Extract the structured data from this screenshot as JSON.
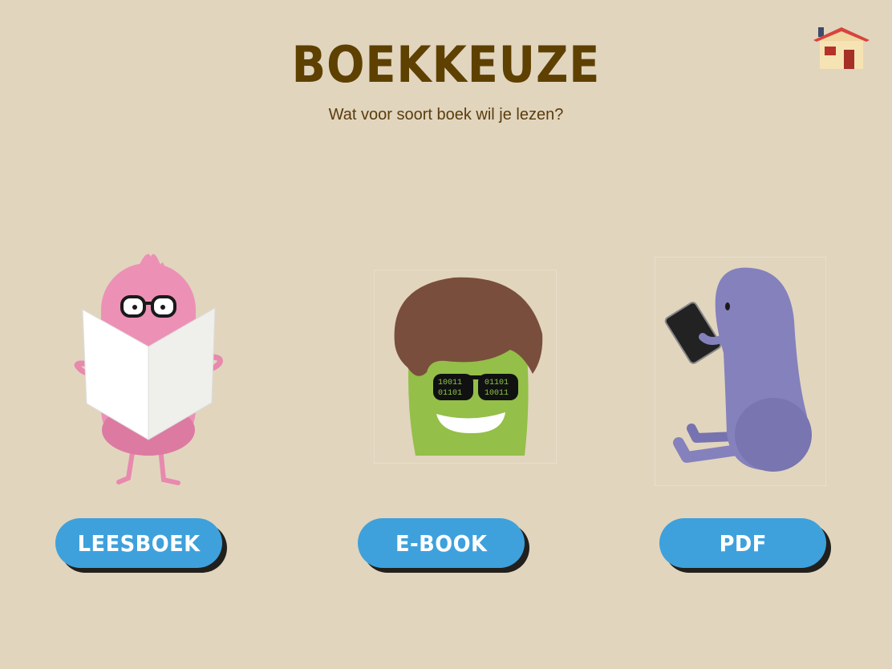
{
  "header": {
    "title": "BOEKKEUZE",
    "subtitle": "Wat voor soort boek wil je lezen?"
  },
  "home": {
    "icon": "house-icon"
  },
  "choices": [
    {
      "label": "LEESBOEK",
      "illustration": "pink-character-reading-newspaper"
    },
    {
      "label": "E-BOOK",
      "illustration": "green-character-with-binary-sunglasses"
    },
    {
      "label": "PDF",
      "illustration": "purple-character-holding-phone"
    }
  ],
  "ebook_glasses": {
    "left_top": "10011",
    "left_bottom": "01101",
    "right_top": "01101",
    "right_bottom": "10011"
  },
  "colors": {
    "background": "#e1d5be",
    "title": "#5e4000",
    "button": "#3ea1dc",
    "button_text": "#ffffff",
    "pink_character": "#ec91b5",
    "green_character": "#94bf48",
    "purple_character": "#8481bd",
    "hair": "#7a4e3c"
  }
}
